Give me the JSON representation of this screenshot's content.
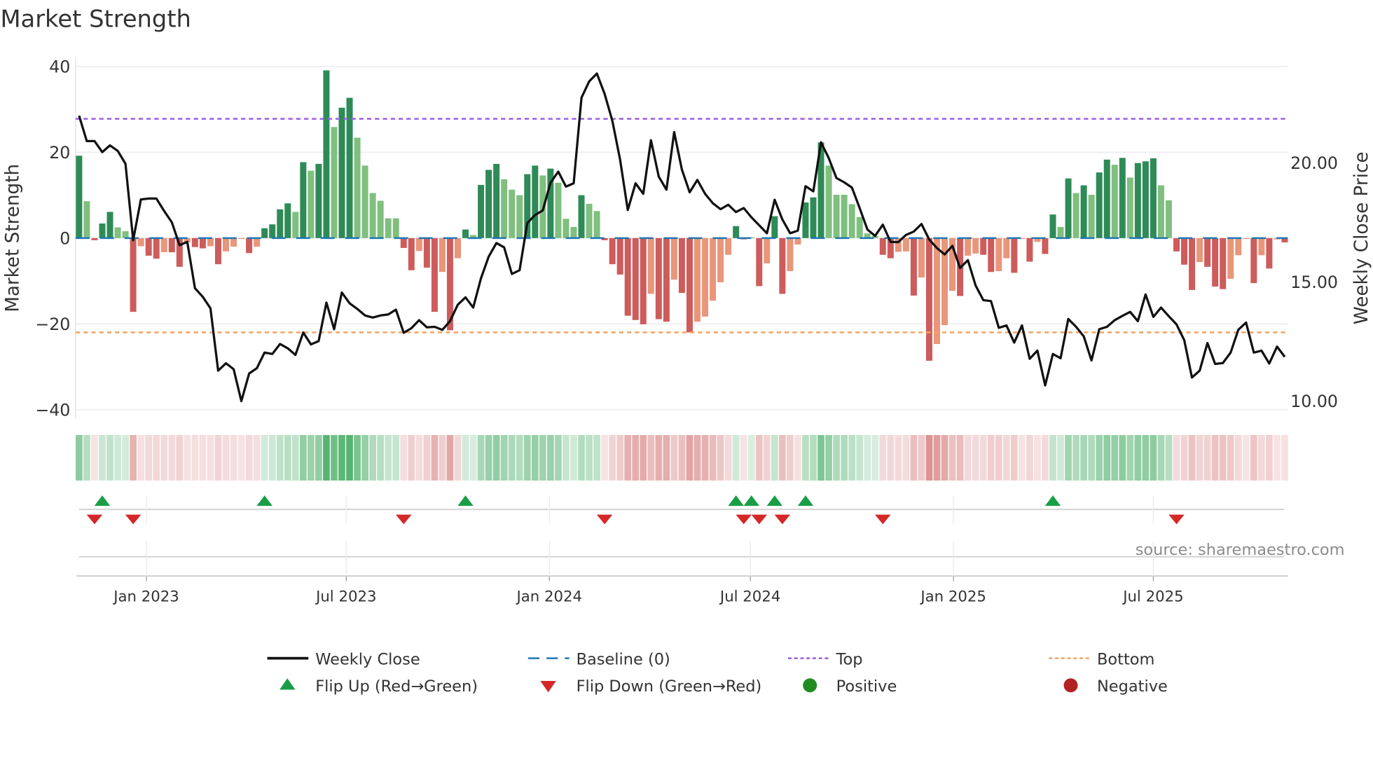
{
  "chart_data": {
    "type": "bar",
    "title": "Market Strength",
    "ylabel": "Market Strength",
    "y2label": "Weekly Close Price",
    "ylim": [
      -42,
      42
    ],
    "y2lim": [
      10,
      22
    ],
    "y_ticks": [
      {
        "v": 40,
        "label": "40"
      },
      {
        "v": 20,
        "label": "20"
      },
      {
        "v": 0,
        "label": "0"
      },
      {
        "v": -20,
        "label": "−20"
      },
      {
        "v": -40,
        "label": "−40"
      }
    ],
    "y2_ticks": [
      {
        "v": 20,
        "label": "20.00"
      },
      {
        "v": 15,
        "label": "15.00"
      },
      {
        "v": 10,
        "label": "10.00"
      }
    ],
    "x_ticks": [
      {
        "date": "2023-01-01",
        "label": "Jan 2023"
      },
      {
        "date": "2023-07-01",
        "label": "Jul 2023"
      },
      {
        "date": "2024-01-01",
        "label": "Jan 2024"
      },
      {
        "date": "2024-07-01",
        "label": "Jul 2024"
      },
      {
        "date": "2025-01-01",
        "label": "Jan 2025"
      },
      {
        "date": "2025-07-01",
        "label": "Jul 2025"
      }
    ],
    "first_week": "2022-11-01",
    "top_level": 27.8,
    "bottom_level": -22,
    "baseline": 0,
    "strength": [
      19.2,
      8.6,
      -0.5,
      3.4,
      6.1,
      2.5,
      1.6,
      -17.2,
      -1.9,
      -4.1,
      -4.8,
      -3.3,
      -3.3,
      -6.7,
      -1.0,
      -2.1,
      -2.4,
      -1.9,
      -6.1,
      -3.1,
      -2.0,
      -0.2,
      -3.5,
      -2.0,
      2.3,
      3.2,
      6.7,
      8.1,
      6.1,
      17.7,
      15.7,
      17.3,
      39.1,
      25.9,
      30.4,
      32.7,
      23.4,
      16.9,
      10.5,
      8.7,
      4.6,
      4.6,
      -2.3,
      -7.5,
      -3.0,
      -6.9,
      -17.2,
      -7.9,
      -21.5,
      -4.7,
      2.0,
      0.7,
      12.4,
      15.9,
      17.3,
      13.7,
      11.3,
      10.0,
      14.9,
      16.9,
      14.6,
      16.2,
      12.9,
      4.5,
      2.6,
      10.0,
      8.0,
      6.3,
      -0.5,
      -6.1,
      -8.5,
      -18.1,
      -19.1,
      -20.1,
      -13.0,
      -18.9,
      -19.5,
      -9.7,
      -12.8,
      -22.0,
      -19.5,
      -18.3,
      -14.6,
      -10.3,
      -3.9,
      2.8,
      -0.3,
      0.2,
      -11.2,
      -5.9,
      5.1,
      -13.0,
      -7.7,
      -1.5,
      8.3,
      9.5,
      22.3,
      16.9,
      10.1,
      10.1,
      7.9,
      4.9,
      1.1,
      0.5,
      -3.9,
      -4.7,
      -3.2,
      -3.1,
      -13.4,
      -9.2,
      -28.6,
      -24.7,
      -20.3,
      -12.3,
      -13.5,
      -4.1,
      -3.6,
      -3.9,
      -7.9,
      -7.7,
      -4.7,
      -8.1,
      -0.2,
      -5.5,
      -0.9,
      -3.7,
      5.5,
      2.6,
      13.9,
      10.5,
      12.3,
      10.1,
      15.3,
      18.3,
      17.1,
      18.7,
      14.1,
      17.5,
      17.9,
      18.6,
      12.3,
      8.8,
      -3.1,
      -6.2,
      -12.1,
      -5.6,
      -6.7,
      -11.3,
      -11.9,
      -9.5,
      -4.0,
      -0.2,
      -10.5,
      -4.0,
      -7.1,
      -0.3,
      -1.0
    ],
    "strong": [
      1,
      0,
      1,
      1,
      1,
      0,
      0,
      1,
      0,
      1,
      1,
      0,
      1,
      1,
      0,
      1,
      1,
      0,
      1,
      0,
      0,
      0,
      1,
      0,
      1,
      1,
      1,
      1,
      0,
      1,
      0,
      1,
      1,
      0,
      1,
      1,
      0,
      0,
      0,
      0,
      0,
      0,
      1,
      1,
      0,
      1,
      1,
      0,
      1,
      0,
      1,
      0,
      1,
      1,
      1,
      0,
      0,
      0,
      1,
      1,
      0,
      1,
      0,
      0,
      0,
      1,
      0,
      0,
      1,
      1,
      1,
      1,
      1,
      1,
      0,
      1,
      1,
      0,
      1,
      1,
      0,
      0,
      0,
      0,
      0,
      1,
      1,
      0,
      1,
      0,
      1,
      1,
      0,
      0,
      1,
      1,
      1,
      0,
      0,
      0,
      0,
      0,
      0,
      0,
      1,
      1,
      0,
      0,
      1,
      0,
      1,
      0,
      0,
      0,
      1,
      0,
      0,
      1,
      1,
      0,
      0,
      1,
      0,
      1,
      0,
      1,
      1,
      0,
      1,
      0,
      1,
      0,
      1,
      1,
      0,
      1,
      0,
      1,
      1,
      1,
      0,
      0,
      1,
      1,
      1,
      0,
      1,
      1,
      1,
      0,
      0,
      0,
      1,
      0,
      1,
      0,
      1
    ],
    "weekly_close": [
      21.98,
      20.91,
      20.91,
      20.45,
      20.73,
      20.5,
      19.96,
      16.75,
      18.46,
      18.5,
      18.5,
      17.98,
      17.5,
      16.54,
      16.68,
      14.73,
      14.37,
      13.89,
      11.27,
      11.58,
      11.33,
      9.99,
      11.15,
      11.37,
      12.03,
      11.97,
      12.39,
      12.21,
      11.93,
      12.87,
      12.37,
      12.51,
      14.13,
      13.01,
      14.55,
      14.1,
      13.86,
      13.59,
      13.5,
      13.59,
      13.63,
      13.83,
      12.86,
      13.05,
      13.39,
      13.09,
      13.11,
      12.98,
      13.35,
      14.04,
      14.35,
      13.92,
      15.15,
      16.06,
      16.63,
      16.45,
      15.33,
      15.49,
      17.47,
      17.81,
      18.0,
      19.16,
      19.63,
      19.0,
      19.14,
      22.73,
      23.42,
      23.75,
      22.9,
      21.76,
      20.14,
      18.02,
      19.14,
      18.7,
      20.95,
      19.42,
      18.87,
      21.29,
      19.72,
      18.76,
      19.28,
      18.7,
      18.3,
      18.05,
      18.24,
      17.93,
      18.1,
      17.71,
      17.38,
      17.04,
      18.45,
      17.62,
      17.04,
      17.15,
      19.02,
      18.8,
      20.86,
      20.2,
      19.36,
      19.18,
      18.96,
      18.1,
      17.2,
      16.93,
      17.4,
      16.68,
      16.67,
      16.97,
      17.11,
      17.43,
      16.78,
      16.42,
      16.15,
      16.51,
      15.58,
      15.91,
      14.85,
      14.23,
      14.19,
      13.07,
      13.17,
      12.45,
      13.17,
      11.77,
      12.11,
      10.65,
      11.97,
      11.79,
      13.44,
      13.11,
      12.71,
      11.7,
      13.01,
      13.11,
      13.39,
      13.57,
      13.74,
      13.35,
      14.47,
      13.53,
      13.92,
      13.56,
      13.21,
      12.55,
      10.98,
      11.27,
      12.43,
      11.55,
      11.59,
      12.03,
      12.99,
      13.29,
      12.03,
      12.11,
      11.57,
      12.28,
      11.85
    ],
    "flip_up_weeks": [
      3,
      24,
      50,
      85,
      87,
      90,
      94,
      126
    ],
    "flip_down_weeks": [
      2,
      7,
      42,
      68,
      86,
      88,
      91,
      104,
      142
    ],
    "colors": {
      "strong_pos": "#2e8b57",
      "weak_pos": "#80bf7f",
      "strong_neg": "#cd5c5c",
      "weak_neg": "#e9967a",
      "line": "#111111",
      "baseline": "#1f77b4",
      "top": "#9b5de5",
      "bottom": "#f4a460",
      "flip_up": "#1a9e45",
      "flip_down": "#d62728",
      "positive": "#228b22",
      "negative": "#b22222"
    },
    "legend": {
      "position": "bottom",
      "items": [
        {
          "label": "Weekly Close",
          "kind": "line"
        },
        {
          "label": "Baseline (0)",
          "kind": "baseline"
        },
        {
          "label": "Top",
          "kind": "top"
        },
        {
          "label": "Bottom",
          "kind": "bottom"
        },
        {
          "label": "Flip Up (Red→Green)",
          "kind": "up"
        },
        {
          "label": "Flip Down (Green→Red)",
          "kind": "down"
        },
        {
          "label": "Positive",
          "kind": "pos"
        },
        {
          "label": "Negative",
          "kind": "neg"
        }
      ]
    },
    "source": "source: sharemaestro.com"
  }
}
